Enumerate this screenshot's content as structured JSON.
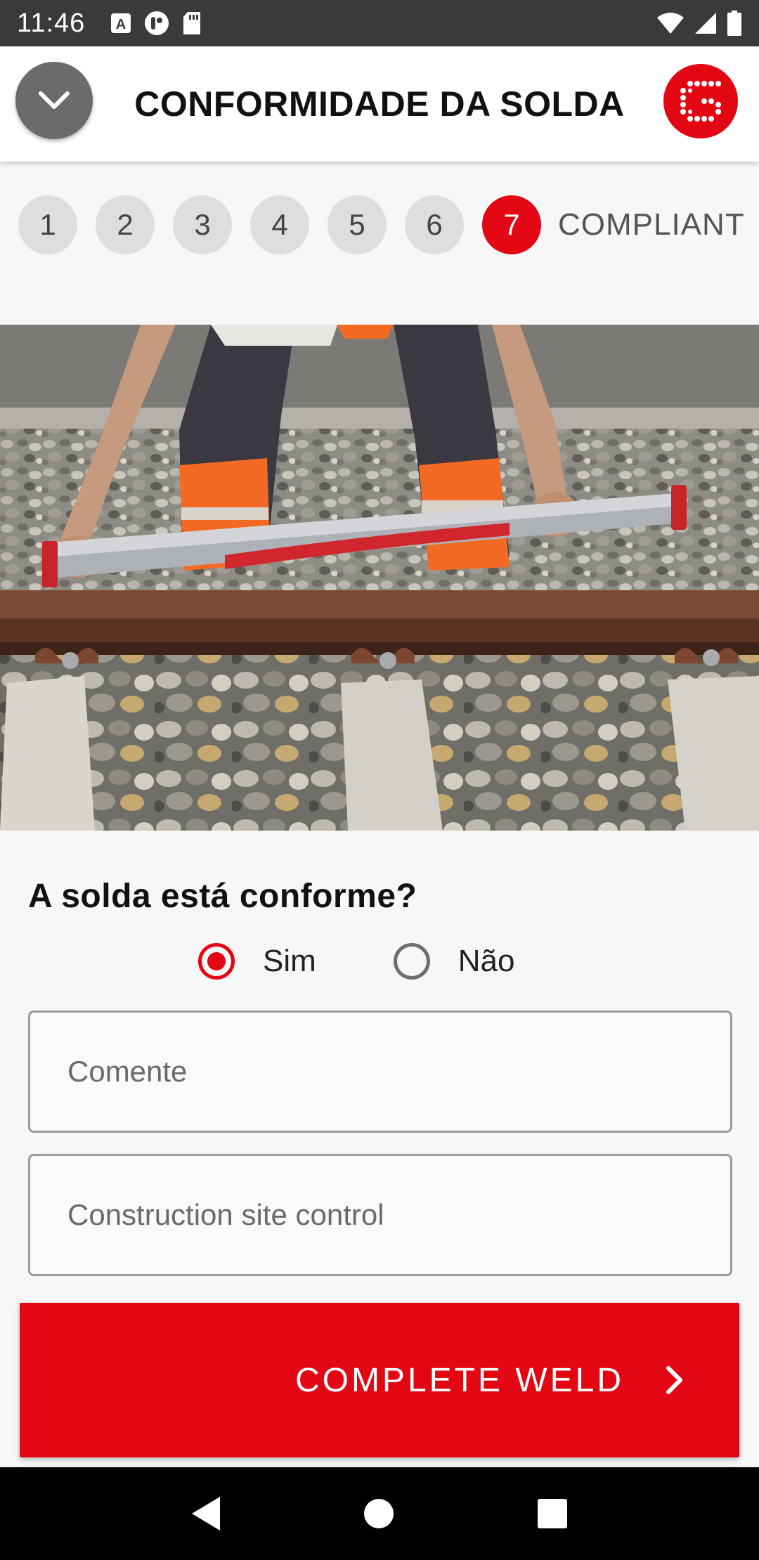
{
  "status_bar": {
    "time": "11:46",
    "icons": [
      "text-notification-icon",
      "account-icon",
      "sd-card-icon"
    ],
    "right_icons": [
      "wifi-icon",
      "signal-icon",
      "battery-icon"
    ]
  },
  "app_bar": {
    "title": "CONFORMIDADE DA SOLDA",
    "collapse_icon": "chevron-down-icon",
    "logo": "brand-logo"
  },
  "steps": {
    "items": [
      "1",
      "2",
      "3",
      "4",
      "5",
      "6",
      "7"
    ],
    "active_index": 6,
    "active_label": "COMPLIANT"
  },
  "hero": {
    "description_icon": "rail-measurement-photo"
  },
  "form": {
    "question": "A solda está conforme?",
    "options": [
      {
        "label": "Sim",
        "checked": true
      },
      {
        "label": "Não",
        "checked": false
      }
    ],
    "comment_placeholder": "Comente",
    "control_placeholder": "Construction site control"
  },
  "action": {
    "complete_label": "COMPLETE WELD"
  },
  "colors": {
    "accent": "#e30613",
    "step_inactive": "#dedede"
  }
}
